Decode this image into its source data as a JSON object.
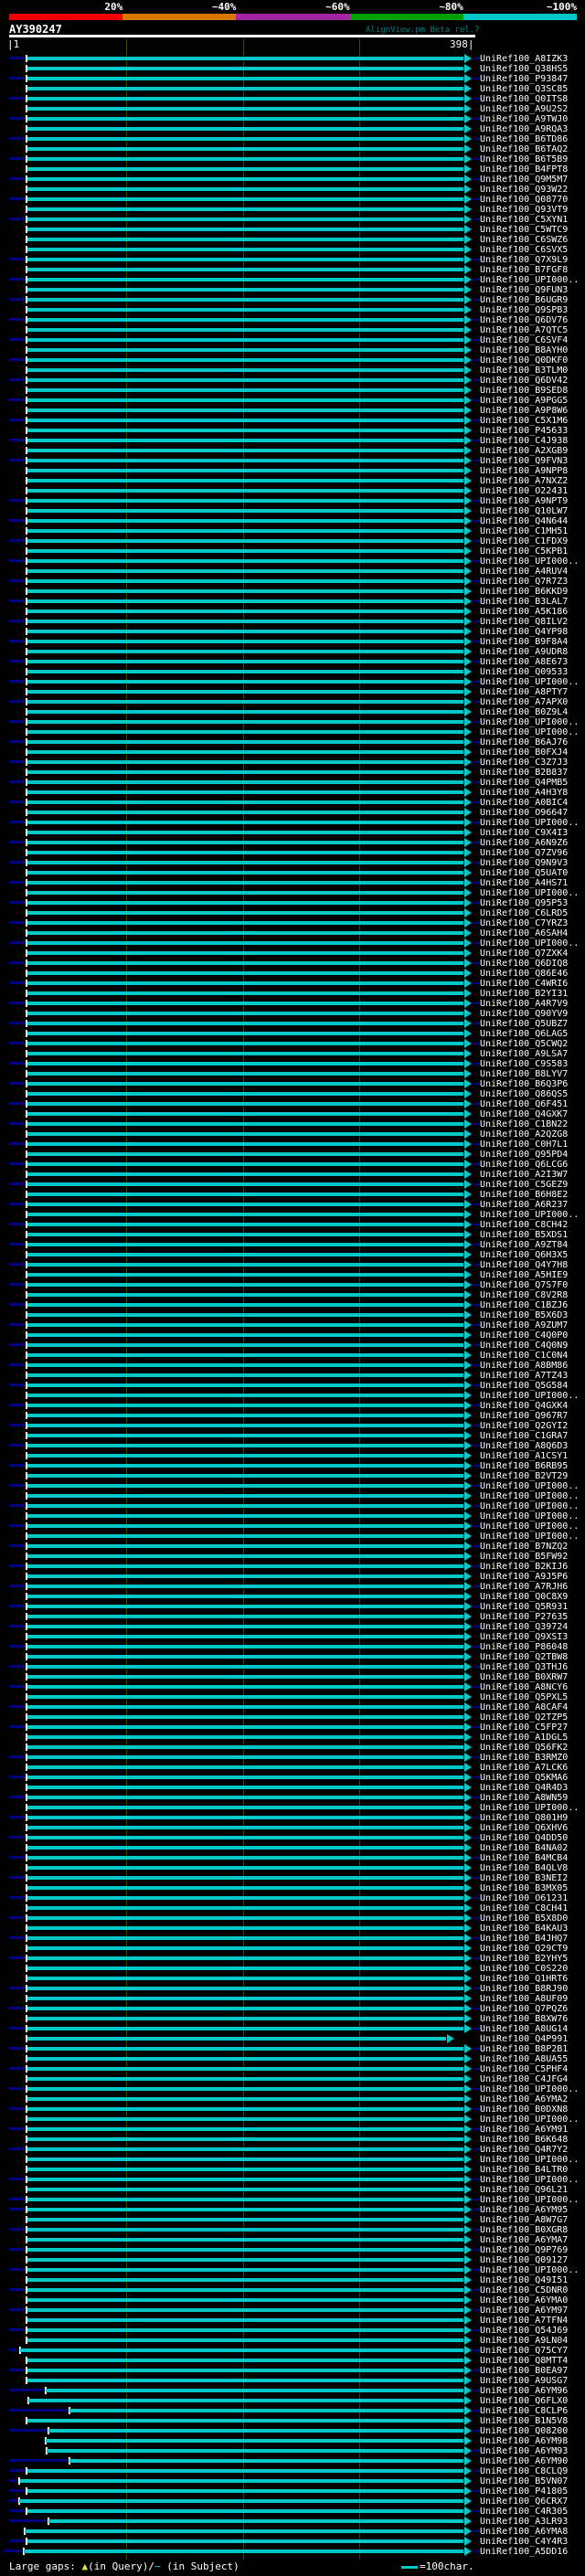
{
  "header": {
    "scale_labels": [
      "20%",
      "~40%",
      "~60%",
      "~80%",
      "~100%"
    ],
    "scale_colors": [
      "#f00000",
      "#d97700",
      "#a325a3",
      "#00a000",
      "#00c8c8"
    ],
    "query_id": "AY390247",
    "app_title": "AlignView.pm Beta rel.7"
  },
  "ruler": {
    "start_label": "|1",
    "end_label": "398|",
    "query_length": 398,
    "gridline_positions": [
      100,
      200,
      300
    ]
  },
  "legend": {
    "large_gaps_prefix": "Large gaps: ",
    "query_marker": "▲",
    "query_text": "(in Query)/",
    "subject_marker": "−",
    "subject_text": " (in Subject)",
    "scale_text": "=100char."
  },
  "colors": {
    "background": "#000000",
    "bar_cyan": "#00c8c8",
    "overhang_navy": "#000080",
    "gridline_olive": "#3e4400",
    "app_title_teal": "#008080",
    "gap_marker_yellow": "#e8e24a",
    "text_white": "#ffffff"
  },
  "plot": {
    "default_bar_start": 30,
    "default_bar_end": 507,
    "left_stub": [
      10,
      28
    ],
    "right_dash": [
      517,
      525
    ],
    "row_count": 249
  },
  "rows": [
    [
      "UniRef100_A8IZK3",
      1
    ],
    [
      "UniRef100_Q38HS5",
      0
    ],
    [
      "UniRef100_P93847",
      1
    ],
    [
      "UniRef100_Q3SC85",
      0
    ],
    [
      "UniRef100_Q0ITS8",
      1
    ],
    [
      "UniRef100_A9U2S2",
      0
    ],
    [
      "UniRef100_A9TWJ0",
      1
    ],
    [
      "UniRef100_A9RQA3",
      0
    ],
    [
      "UniRef100_B6TD86",
      1
    ],
    [
      "UniRef100_B6TAQ2",
      0
    ],
    [
      "UniRef100_B6T5B9",
      1
    ],
    [
      "UniRef100_B4FPT8",
      0
    ],
    [
      "UniRef100_Q9M5M7",
      1
    ],
    [
      "UniRef100_Q93W22",
      0
    ],
    [
      "UniRef100_Q08770",
      1
    ],
    [
      "UniRef100_Q93VT9",
      0
    ],
    [
      "UniRef100_C5XYN1",
      1
    ],
    [
      "UniRef100_C5WTC9",
      0
    ],
    [
      "UniRef100_C6SWZ6",
      0
    ],
    [
      "UniRef100_C6SVX5",
      0
    ],
    [
      "UniRef100_Q7X9L9",
      1
    ],
    [
      "UniRef100_B7FGF8",
      0
    ],
    [
      "UniRef100_UPI000..",
      1
    ],
    [
      "UniRef100_Q9FUN3",
      0
    ],
    [
      "UniRef100_B6UGR9",
      1
    ],
    [
      "UniRef100_Q9SPB3",
      0
    ],
    [
      "UniRef100_Q6DV76",
      1
    ],
    [
      "UniRef100_A7QTC5",
      0
    ],
    [
      "UniRef100_C6SVF4",
      1
    ],
    [
      "UniRef100_B8AYH0",
      0
    ],
    [
      "UniRef100_Q0DKF0",
      1
    ],
    [
      "UniRef100_B3TLM0",
      0
    ],
    [
      "UniRef100_Q6DV42",
      1
    ],
    [
      "UniRef100_B9SED8",
      0
    ],
    [
      "UniRef100_A9PGG5",
      1
    ],
    [
      "UniRef100_A9P8W6",
      0
    ],
    [
      "UniRef100_C5X1M6",
      1
    ],
    [
      "UniRef100_P45633",
      0
    ],
    [
      "UniRef100_C4J938",
      1
    ],
    [
      "UniRef100_A2XGB9",
      0
    ],
    [
      "UniRef100_Q9FVN3",
      1
    ],
    [
      "UniRef100_A9NPP8",
      0
    ],
    [
      "UniRef100_A7NXZ2",
      0
    ],
    [
      "UniRef100_O22431",
      0
    ],
    [
      "UniRef100_A9NPT9",
      1
    ],
    [
      "UniRef100_Q10LW7",
      0
    ],
    [
      "UniRef100_Q4N644",
      1
    ],
    [
      "UniRef100_C1MH51",
      0
    ],
    [
      "UniRef100_C1FDX9",
      1
    ],
    [
      "UniRef100_C5KPB1",
      0
    ],
    [
      "UniRef100_UPI000..",
      1
    ],
    [
      "UniRef100_A4RUV4",
      0
    ],
    [
      "UniRef100_Q7R7Z3",
      1
    ],
    [
      "UniRef100_B6KKD9",
      0
    ],
    [
      "UniRef100_B3LAL7",
      1
    ],
    [
      "UniRef100_A5K186",
      0
    ],
    [
      "UniRef100_Q8ILV2",
      1
    ],
    [
      "UniRef100_Q4YP98",
      0
    ],
    [
      "UniRef100_B9F8A4",
      1
    ],
    [
      "UniRef100_A9UDR8",
      0
    ],
    [
      "UniRef100_A8E673",
      1
    ],
    [
      "UniRef100_Q09533",
      0
    ],
    [
      "UniRef100_UPI000..",
      1
    ],
    [
      "UniRef100_A8PTY7",
      0
    ],
    [
      "UniRef100_A7APX0",
      1
    ],
    [
      "UniRef100_B0Z9L4",
      0
    ],
    [
      "UniRef100_UPI000..",
      1
    ],
    [
      "UniRef100_UPI000..",
      0
    ],
    [
      "UniRef100_B6AJ76",
      1
    ],
    [
      "UniRef100_B0FXJ4",
      0
    ],
    [
      "UniRef100_C3Z7J3",
      1
    ],
    [
      "UniRef100_B2B837",
      0
    ],
    [
      "UniRef100_Q4PMB5",
      1
    ],
    [
      "UniRef100_A4H3Y8",
      0
    ],
    [
      "UniRef100_A0BIC4",
      1
    ],
    [
      "UniRef100_O96647",
      0
    ],
    [
      "UniRef100_UPI000..",
      1
    ],
    [
      "UniRef100_C9X4I3",
      0
    ],
    [
      "UniRef100_A6N9Z6",
      1
    ],
    [
      "UniRef100_Q7ZV96",
      0
    ],
    [
      "UniRef100_Q9N9V3",
      1
    ],
    [
      "UniRef100_Q5UAT0",
      0
    ],
    [
      "UniRef100_A4HS71",
      1
    ],
    [
      "UniRef100_UPI000..",
      0
    ],
    [
      "UniRef100_Q95P53",
      1
    ],
    [
      "UniRef100_C6LRD5",
      0
    ],
    [
      "UniRef100_C7YRZ3",
      1
    ],
    [
      "UniRef100_A6SAH4",
      0
    ],
    [
      "UniRef100_UPI000..",
      1
    ],
    [
      "UniRef100_Q7ZXK4",
      0
    ],
    [
      "UniRef100_Q6DIQ8",
      1
    ],
    [
      "UniRef100_Q86E46",
      0
    ],
    [
      "UniRef100_C4WRI6",
      1
    ],
    [
      "UniRef100_B2YI31",
      0
    ],
    [
      "UniRef100_A4R7V9",
      1
    ],
    [
      "UniRef100_Q90YV9",
      0
    ],
    [
      "UniRef100_Q5UBZ7",
      1
    ],
    [
      "UniRef100_Q6LAG5",
      0
    ],
    [
      "UniRef100_Q5CWQ2",
      1
    ],
    [
      "UniRef100_A9LSA7",
      0
    ],
    [
      "UniRef100_C9S583",
      1
    ],
    [
      "UniRef100_B8LYV7",
      0
    ],
    [
      "UniRef100_B6Q3P6",
      1
    ],
    [
      "UniRef100_Q86QS5",
      0
    ],
    [
      "UniRef100_Q6F451",
      1
    ],
    [
      "UniRef100_Q4GXK7",
      0
    ],
    [
      "UniRef100_C1BN22",
      1
    ],
    [
      "UniRef100_A2QZG8",
      0
    ],
    [
      "UniRef100_C0H7L1",
      1
    ],
    [
      "UniRef100_Q95PD4",
      0
    ],
    [
      "UniRef100_Q6LCG6",
      1
    ],
    [
      "UniRef100_A2I3W7",
      0
    ],
    [
      "UniRef100_C5GEZ9",
      1
    ],
    [
      "UniRef100_B6H8E2",
      0
    ],
    [
      "UniRef100_A6R237",
      1
    ],
    [
      "UniRef100_UPI000..",
      0
    ],
    [
      "UniRef100_C8CH42",
      1
    ],
    [
      "UniRef100_B5XDS1",
      0
    ],
    [
      "UniRef100_A9ZT84",
      1
    ],
    [
      "UniRef100_Q6H3X5",
      0
    ],
    [
      "UniRef100_Q4Y7H8",
      1
    ],
    [
      "UniRef100_A5HIE9",
      0
    ],
    [
      "UniRef100_Q7S7F0",
      1
    ],
    [
      "UniRef100_C8V2R8",
      0
    ],
    [
      "UniRef100_C1BZJ6",
      1
    ],
    [
      "UniRef100_B5X6D3",
      0
    ],
    [
      "UniRef100_A9ZUM7",
      1
    ],
    [
      "UniRef100_C4Q0P0",
      0
    ],
    [
      "UniRef100_C4Q0N9",
      1
    ],
    [
      "UniRef100_C1C0N4",
      0
    ],
    [
      "UniRef100_A8BM86",
      1
    ],
    [
      "UniRef100_A7TZ43",
      0
    ],
    [
      "UniRef100_Q5G584",
      1
    ],
    [
      "UniRef100_UPI000..",
      0
    ],
    [
      "UniRef100_Q4GXK4",
      1
    ],
    [
      "UniRef100_Q967R7",
      0
    ],
    [
      "UniRef100_Q2GYI2",
      1
    ],
    [
      "UniRef100_C1GRA7",
      0
    ],
    [
      "UniRef100_A8Q6D3",
      1
    ],
    [
      "UniRef100_A1CSY1",
      0
    ],
    [
      "UniRef100_B6RB95",
      1
    ],
    [
      "UniRef100_B2VT29",
      0
    ],
    [
      "UniRef100_UPI000..",
      1
    ],
    [
      "UniRef100_UPI000..",
      0
    ],
    [
      "UniRef100_UPI000..",
      1
    ],
    [
      "UniRef100_UPI000..",
      0
    ],
    [
      "UniRef100_UPI000..",
      1
    ],
    [
      "UniRef100_UPI000..",
      0
    ],
    [
      "UniRef100_B7NZQ2",
      1
    ],
    [
      "UniRef100_B5FW92",
      0
    ],
    [
      "UniRef100_B2KIJ6",
      1
    ],
    [
      "UniRef100_A9J5P6",
      0
    ],
    [
      "UniRef100_A7RJH6",
      1
    ],
    [
      "UniRef100_Q0C8X9",
      0
    ],
    [
      "UniRef100_Q5R931",
      1
    ],
    [
      "UniRef100_P27635",
      0
    ],
    [
      "UniRef100_Q39724",
      1
    ],
    [
      "UniRef100_Q9XSI3",
      0
    ],
    [
      "UniRef100_P86048",
      1
    ],
    [
      "UniRef100_Q2TBW8",
      0
    ],
    [
      "UniRef100_Q3THJ6",
      1
    ],
    [
      "UniRef100_B0XRW7",
      0
    ],
    [
      "UniRef100_A8NCY6",
      1
    ],
    [
      "UniRef100_Q5PXL5",
      0
    ],
    [
      "UniRef100_A8CAF4",
      1
    ],
    [
      "UniRef100_Q2TZP5",
      0
    ],
    [
      "UniRef100_C5FP27",
      1
    ],
    [
      "UniRef100_A1DGL5",
      0
    ],
    [
      "UniRef100_Q56FK2",
      0
    ],
    [
      "UniRef100_B3RMZ0",
      1
    ],
    [
      "UniRef100_A7LCK6",
      0
    ],
    [
      "UniRef100_Q5KMA6",
      1
    ],
    [
      "UniRef100_Q4R4D3",
      0
    ],
    [
      "UniRef100_A8WN59",
      1
    ],
    [
      "UniRef100_UPI000..",
      0
    ],
    [
      "UniRef100_Q801H9",
      1
    ],
    [
      "UniRef100_Q6XHV6",
      0
    ],
    [
      "UniRef100_Q4DD50",
      1
    ],
    [
      "UniRef100_B4NA02",
      0
    ],
    [
      "UniRef100_B4MCB4",
      1
    ],
    [
      "UniRef100_B4QLV8",
      0
    ],
    [
      "UniRef100_B3NEI2",
      1
    ],
    [
      "UniRef100_B3MX05",
      0
    ],
    [
      "UniRef100_O61231",
      1
    ],
    [
      "UniRef100_C8CH41",
      0
    ],
    [
      "UniRef100_B5X8D0",
      1
    ],
    [
      "UniRef100_B4KAU3",
      0
    ],
    [
      "UniRef100_B4JHQ7",
      1
    ],
    [
      "UniRef100_Q29CT9",
      0
    ],
    [
      "UniRef100_B2YHY5",
      1
    ],
    [
      "UniRef100_C0S220",
      0
    ],
    [
      "UniRef100_Q1HRT6",
      0
    ],
    [
      "UniRef100_B8RJ90",
      1
    ],
    [
      "UniRef100_A8UF09",
      0
    ],
    [
      "UniRef100_Q7PQZ6",
      1
    ],
    [
      "UniRef100_B8XW76",
      0
    ],
    [
      "UniRef100_A8UG14",
      1
    ],
    [
      "UniRef100_Q4P991",
      0,
      {
        "be": 488
      }
    ],
    [
      "UniRef100_B8P2B1",
      1
    ],
    [
      "UniRef100_A8UA55",
      0
    ],
    [
      "UniRef100_C5PHF4",
      1
    ],
    [
      "UniRef100_C4JFG4",
      0
    ],
    [
      "UniRef100_UPI000..",
      1
    ],
    [
      "UniRef100_A6YMA2",
      0
    ],
    [
      "UniRef100_B0DXN8",
      1
    ],
    [
      "UniRef100_UPI000..",
      0
    ],
    [
      "UniRef100_A6YM91",
      1
    ],
    [
      "UniRef100_B6K648",
      0
    ],
    [
      "UniRef100_Q4R7Y2",
      1
    ],
    [
      "UniRef100_UPI000..",
      0
    ],
    [
      "UniRef100_B4LTR0",
      0
    ],
    [
      "UniRef100_UPI000..",
      1
    ],
    [
      "UniRef100_Q96L21",
      0
    ],
    [
      "UniRef100_UPI000..",
      1
    ],
    [
      "UniRef100_A6YM95",
      1
    ],
    [
      "UniRef100_A8W7G7",
      0
    ],
    [
      "UniRef100_B0XGR8",
      1
    ],
    [
      "UniRef100_A6YMA7",
      0
    ],
    [
      "UniRef100_Q9P769",
      1
    ],
    [
      "UniRef100_Q09127",
      0
    ],
    [
      "UniRef100_UPI000..",
      1
    ],
    [
      "UniRef100_Q49I51",
      0
    ],
    [
      "UniRef100_C5DNR0",
      1
    ],
    [
      "UniRef100_A6YMA0",
      0
    ],
    [
      "UniRef100_A6YM97",
      1
    ],
    [
      "UniRef100_A7TFN4",
      0
    ],
    [
      "UniRef100_Q54J69",
      1
    ],
    [
      "UniRef100_A9LN04",
      0
    ],
    [
      "UniRef100_Q75CY7",
      1,
      {
        "ln": [
          10,
          18
        ],
        "tk": 21,
        "bs": 22
      }
    ],
    [
      "UniRef100_Q8MTT4",
      0
    ],
    [
      "UniRef100_B0EA97",
      1
    ],
    [
      "UniRef100_A9USG7",
      0
    ],
    [
      "UniRef100_A6YM96",
      1,
      {
        "ln": [
          10,
          48
        ],
        "tk": 49,
        "bs": 50
      }
    ],
    [
      "UniRef100_Q6FLX0",
      0,
      {
        "tk": 30,
        "bs": 31
      }
    ],
    [
      "UniRef100_C8CLP6",
      1,
      {
        "ln": [
          10,
          74
        ],
        "tk": 75,
        "bs": 76
      }
    ],
    [
      "UniRef100_B1N5V8",
      0
    ],
    [
      "UniRef100_Q08200",
      1,
      {
        "ln": [
          10,
          51
        ],
        "tk": 52,
        "bs": 53
      }
    ],
    [
      "UniRef100_A6YM98",
      0,
      {
        "tk": 49,
        "bs": 50
      }
    ],
    [
      "UniRef100_A6YM93",
      1,
      {
        "ln": 0,
        "tk": 50,
        "bs": 51
      }
    ],
    [
      "UniRef100_A6YM90",
      0,
      {
        "ln": [
          10,
          74
        ],
        "tk": 75,
        "bs": 76
      }
    ],
    [
      "UniRef100_C8CLQ9",
      1
    ],
    [
      "UniRef100_B5VN07",
      0,
      {
        "ln": [
          10,
          18
        ],
        "tk": 20,
        "bs": 22
      }
    ],
    [
      "UniRef100_P41805",
      1
    ],
    [
      "UniRef100_Q6CRX7",
      0,
      {
        "ln": [
          10,
          19
        ],
        "tk": 20,
        "bs": 21
      }
    ],
    [
      "UniRef100_C4R305",
      1
    ],
    [
      "UniRef100_A3LR93",
      0,
      {
        "ln": [
          10,
          50
        ],
        "tk": 52,
        "bs": 53
      }
    ],
    [
      "UniRef100_A6YMA8",
      1,
      {
        "ln": 0,
        "tk": 26,
        "bs": 27
      }
    ],
    [
      "UniRef100_C4Y4R3",
      0,
      {
        "ln": [
          10,
          28
        ]
      }
    ],
    [
      "UniRef100_A5DD16",
      1,
      {
        "ln": [
          4,
          24
        ],
        "tk": 25,
        "bs": 26
      }
    ]
  ]
}
